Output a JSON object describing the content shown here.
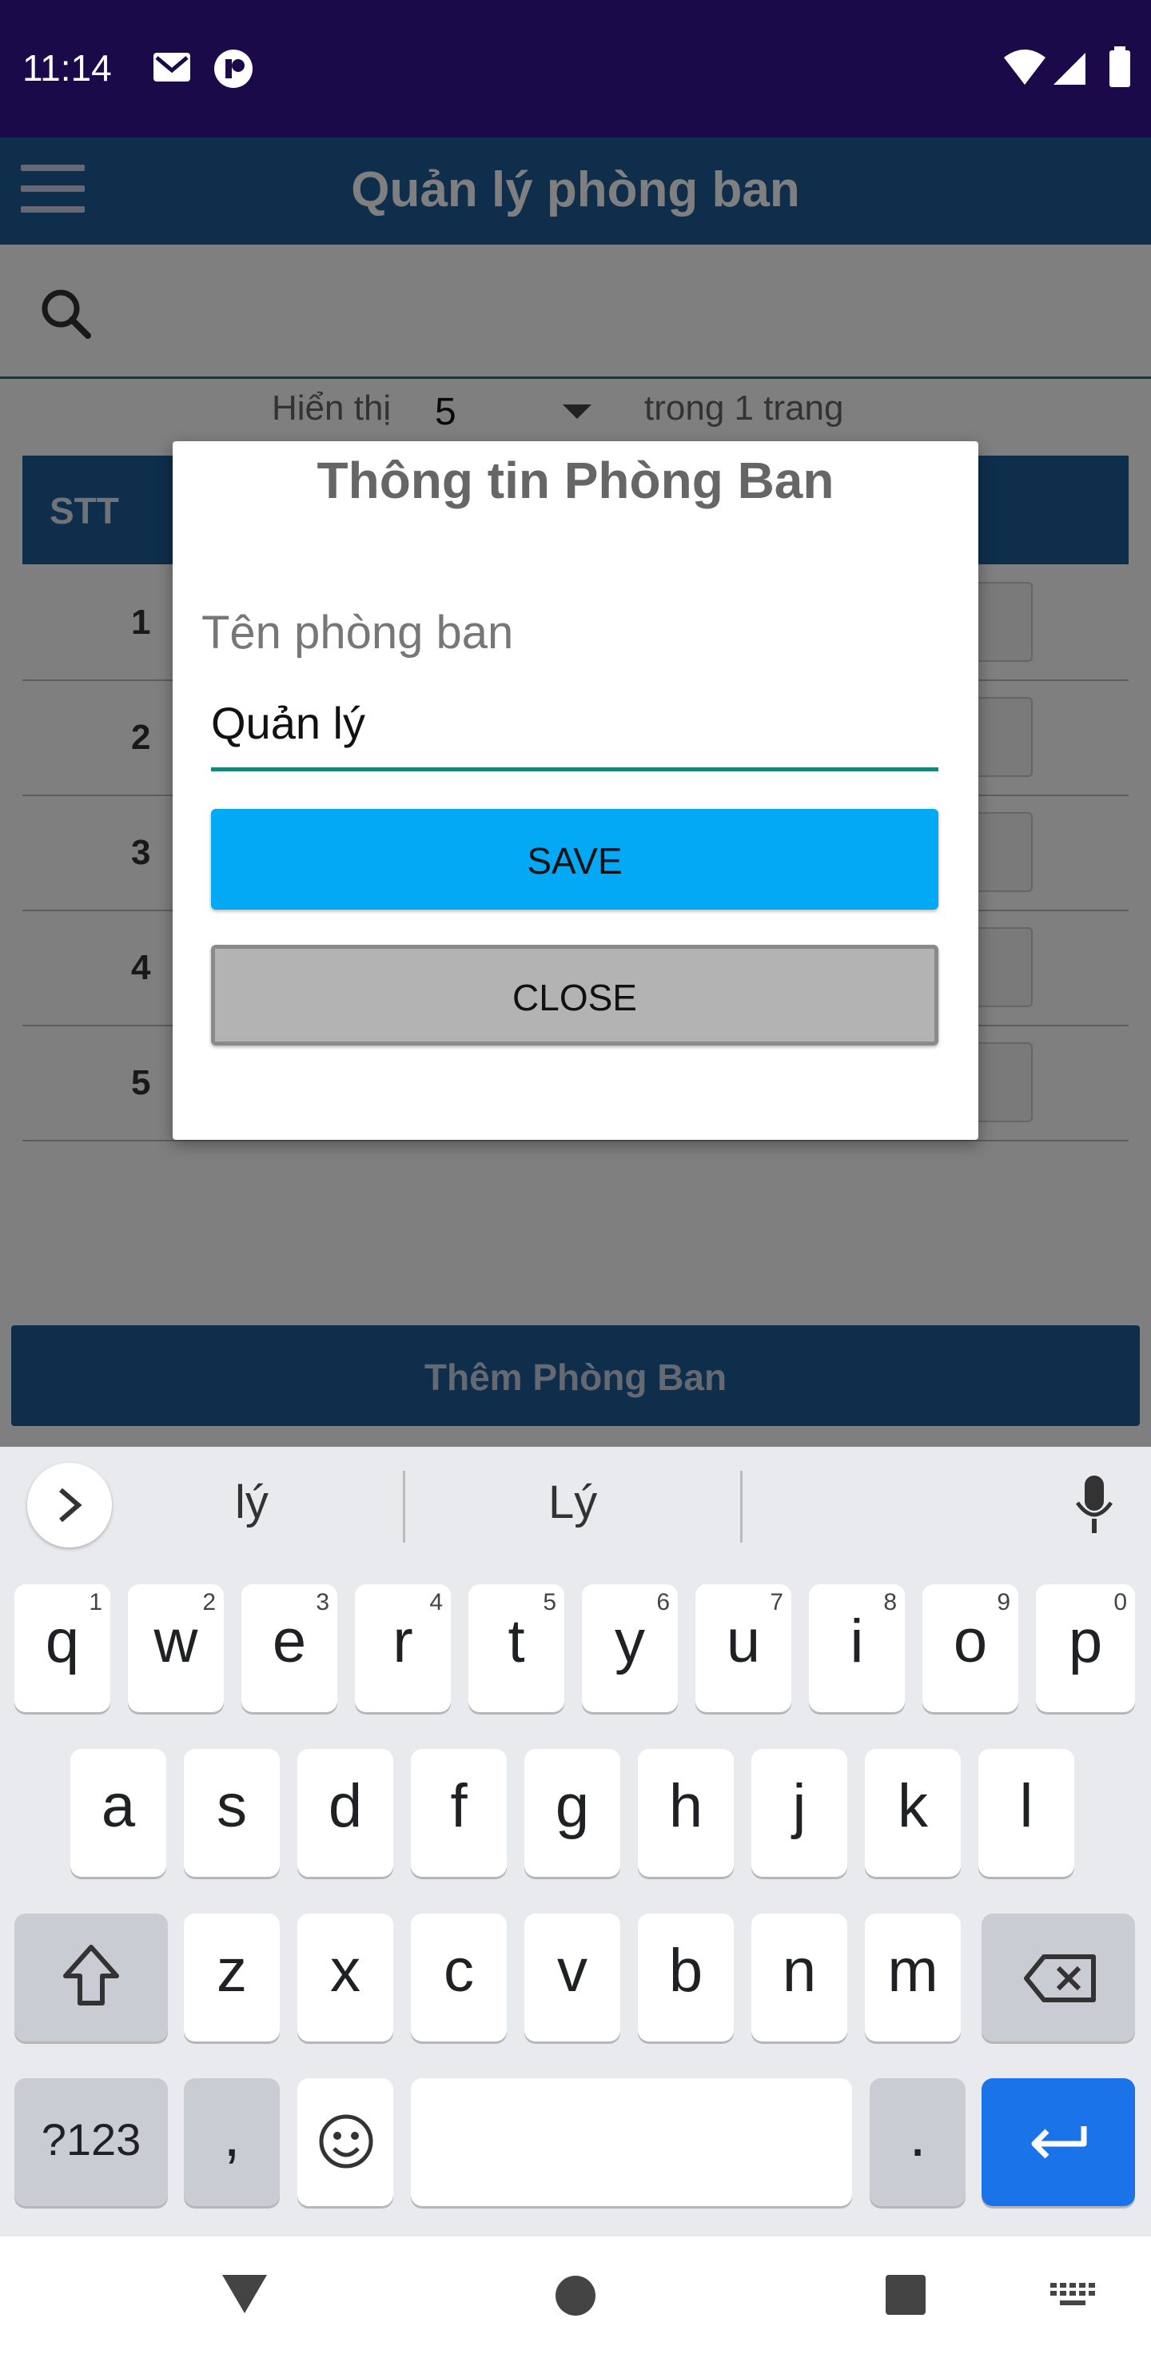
{
  "status_bar": {
    "time": "11:14"
  },
  "app_bar": {
    "title": "Quản lý phòng ban"
  },
  "search": {
    "placeholder": ""
  },
  "paging": {
    "show_label": "Hiển thị",
    "page_size": "5",
    "pages_text": "trong 1 trang"
  },
  "table": {
    "header_stt": "STT",
    "rows": [
      "1",
      "2",
      "3",
      "4",
      "5"
    ]
  },
  "add_button": {
    "label": "Thêm Phòng Ban"
  },
  "dialog": {
    "title": "Thông tin Phòng Ban",
    "field_label": "Tên phòng ban",
    "field_value": "Quản lý",
    "save_label": "SAVE",
    "close_label": "CLOSE"
  },
  "keyboard": {
    "suggestions": [
      "lý",
      "Lý"
    ],
    "row1": [
      {
        "k": "q",
        "h": "1"
      },
      {
        "k": "w",
        "h": "2"
      },
      {
        "k": "e",
        "h": "3"
      },
      {
        "k": "r",
        "h": "4"
      },
      {
        "k": "t",
        "h": "5"
      },
      {
        "k": "y",
        "h": "6"
      },
      {
        "k": "u",
        "h": "7"
      },
      {
        "k": "i",
        "h": "8"
      },
      {
        "k": "o",
        "h": "9"
      },
      {
        "k": "p",
        "h": "0"
      }
    ],
    "row2": [
      "a",
      "s",
      "d",
      "f",
      "g",
      "h",
      "j",
      "k",
      "l"
    ],
    "row3": [
      "z",
      "x",
      "c",
      "v",
      "b",
      "n",
      "m"
    ],
    "symbols_label": "?123",
    "comma": ",",
    "period": "."
  },
  "colors": {
    "app_bar": "#1f5c99",
    "save_button": "#03a9f4",
    "close_button": "#b3b3b3",
    "enter_key": "#1a73e8"
  }
}
